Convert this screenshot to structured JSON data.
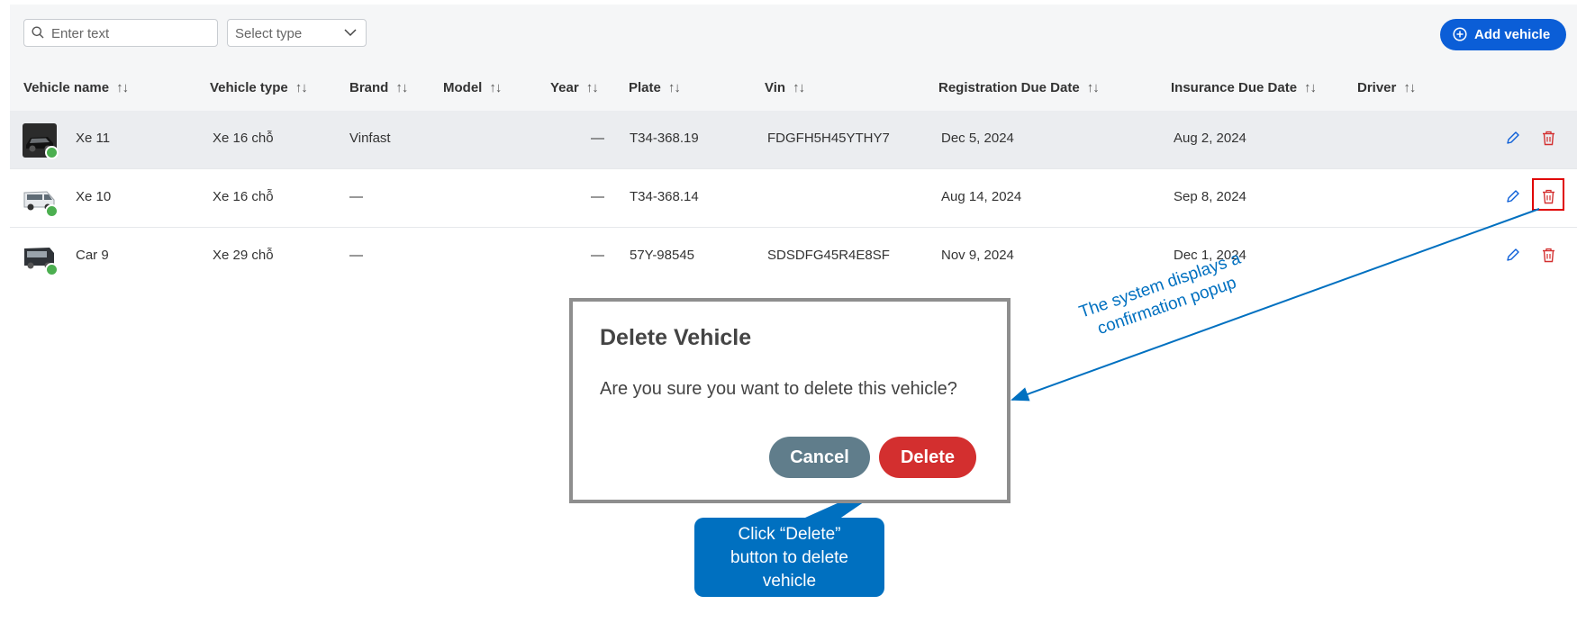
{
  "toolbar": {
    "search_placeholder": "Enter text",
    "type_select": "Select type",
    "add_button": "Add vehicle"
  },
  "table": {
    "headers": [
      "Vehicle name",
      "Vehicle type",
      "Brand",
      "Model",
      "Year",
      "Plate",
      "Vin",
      "Registration Due Date",
      "Insurance Due Date",
      "Driver"
    ],
    "sort_glyph": "↑↓",
    "rows": [
      {
        "name": "Xe 11",
        "type": "Xe 16 chỗ",
        "brand": "Vinfast",
        "model": "",
        "year": "—",
        "plate": "T34-368.19",
        "vin": "FDGFH5H45YTHY7",
        "registration": "Dec 5, 2024",
        "insurance": "Aug 2, 2024",
        "driver": "",
        "status": "online"
      },
      {
        "name": "Xe 10",
        "type": "Xe 16 chỗ",
        "brand": "—",
        "model": "",
        "year": "—",
        "plate": "T34-368.14",
        "vin": "",
        "registration": "Aug 14, 2024",
        "insurance": "Sep 8, 2024",
        "driver": "",
        "status": "online"
      },
      {
        "name": "Car 9",
        "type": "Xe 29 chỗ",
        "brand": "—",
        "model": "",
        "year": "—",
        "plate": "57Y-98545",
        "vin": "SDSDFG45R4E8SF",
        "registration": "Nov 9, 2024",
        "insurance": "Dec 1, 2024",
        "driver": "",
        "status": "online"
      }
    ]
  },
  "modal": {
    "title": "Delete Vehicle",
    "message": "Are you sure you want to delete this vehicle?",
    "cancel": "Cancel",
    "delete": "Delete"
  },
  "annotations": {
    "popup_note_line1": "The system displays a",
    "popup_note_line2": "confirmation popup",
    "callout_line1": "Click “Delete”",
    "callout_line2": "button to delete",
    "callout_line3": "vehicle"
  },
  "colors": {
    "primary": "#0b5ed7",
    "danger": "#d32f2f",
    "cancel": "#607d8b",
    "annotation": "#0070c0",
    "status_online": "#4caf50"
  }
}
